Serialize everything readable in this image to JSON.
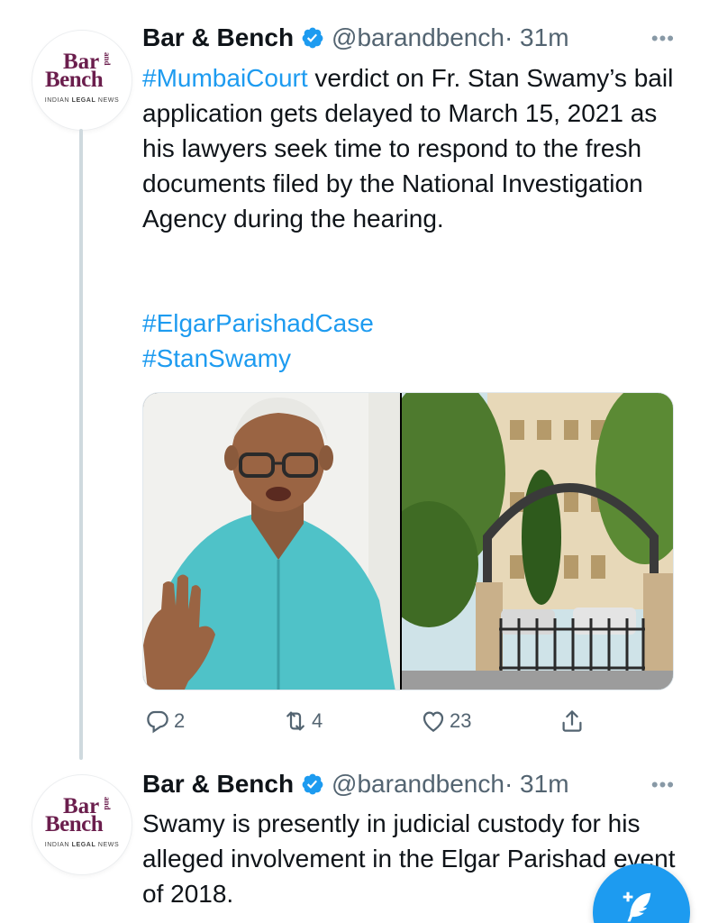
{
  "colors": {
    "accent": "#1d9bf0",
    "brand": "#6b1e4d",
    "text": "#0f1419",
    "muted": "#536471"
  },
  "logo": {
    "line1": "Bar",
    "line2": "Bench",
    "and": "and",
    "subtitle_a": "INDIAN ",
    "subtitle_b": "LEGAL",
    "subtitle_c": " NEWS"
  },
  "tweets": [
    {
      "author": "Bar & Bench",
      "handle": "@barandbench",
      "time": "· 31m",
      "more": "•••",
      "hashtag_lead": "#MumbaiCourt",
      "body": " verdict on Fr. Stan Swamy’s bail application gets delayed to March 15, 2021 as his lawyers seek time to respond to the fresh documents filed by the National Investigation Agency during the hearing.",
      "tags": [
        "#ElgarParishadCase",
        "#StanSwamy"
      ],
      "media": [
        "portrait-photo",
        "court-building-photo"
      ],
      "actions": {
        "reply_count": "2",
        "retweet_count": "4",
        "like_count": "23",
        "share_icon": "share-icon"
      }
    },
    {
      "author": "Bar & Bench",
      "handle": "@barandbench",
      "time": "· 31m",
      "more": "•••",
      "body": "Swamy is presently in judicial custody for his alleged involvement in the Elgar Parishad event of 2018."
    }
  ],
  "fab": {
    "icon": "compose-tweet-icon"
  }
}
